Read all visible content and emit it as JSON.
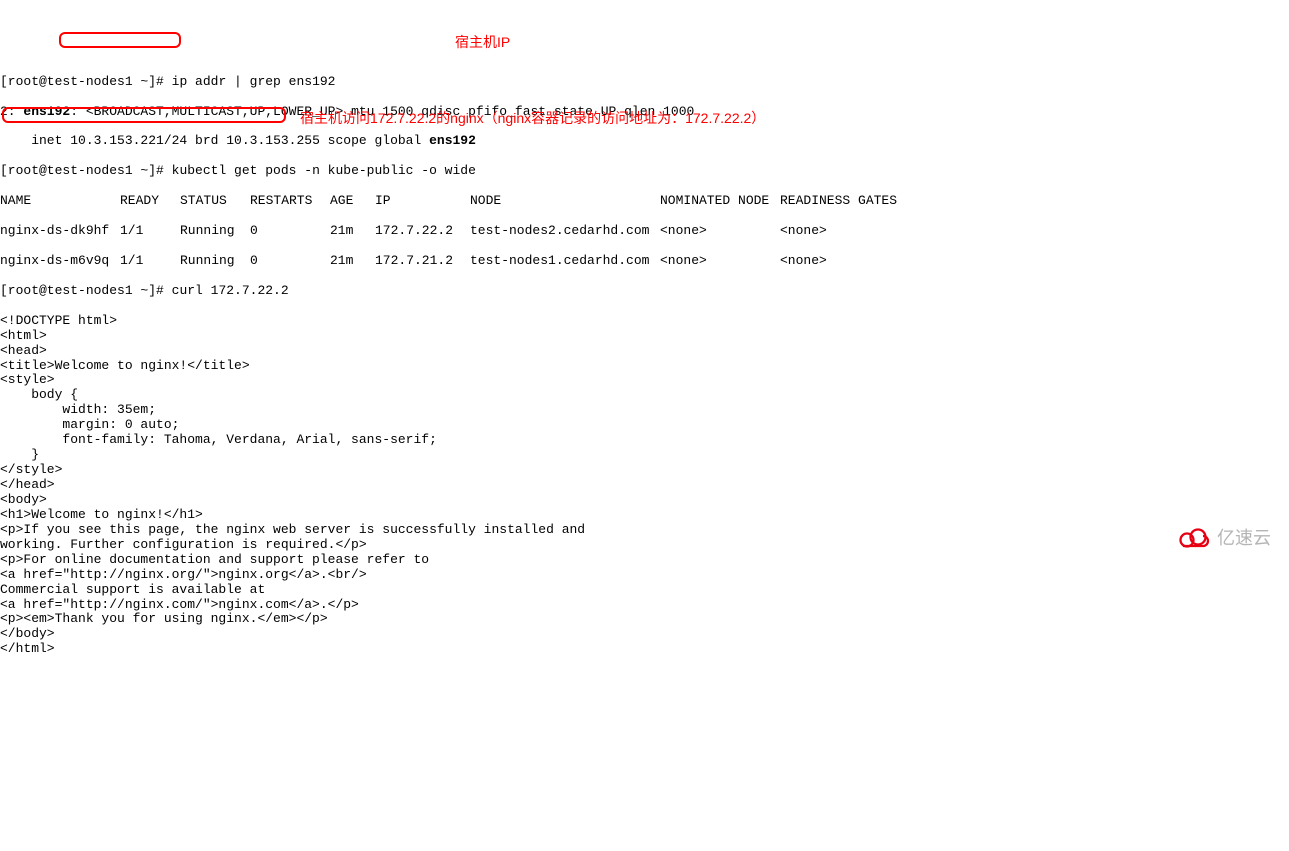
{
  "prompt1": "[root@test-nodes1 ~]# ",
  "cmd1": "ip addr | grep ens192",
  "iface_line_prefix": "2: ",
  "iface_name": "ens192",
  "iface_flags": ": <BROADCAST,MULTICAST,UP,LOWER_UP>",
  "iface_rest": " mtu 1500 qdisc pfifo_fast state UP qlen 1000",
  "inet_prefix": "    inet ",
  "inet_ip": "10.3.153.221/24",
  "inet_mid": " brd 10.3.153.255 scope global ",
  "inet_iface": "ens192",
  "annotation1": "宿主机IP",
  "prompt2": "[root@test-nodes1 ~]# ",
  "cmd2": "kubectl get pods -n kube-public -o wide",
  "headers": {
    "name": "NAME",
    "ready": "READY",
    "status": "STATUS",
    "restarts": "RESTARTS",
    "age": "AGE",
    "ip": "IP",
    "node": "NODE",
    "nominated": "NOMINATED NODE",
    "gates": "READINESS GATES"
  },
  "pods": [
    {
      "name": "nginx-ds-dk9hf",
      "ready": "1/1",
      "status": "Running",
      "restarts": "0",
      "age": "21m",
      "ip": "172.7.22.2",
      "node": "test-nodes2.cedarhd.com",
      "nominated": "<none>",
      "gates": "<none>"
    },
    {
      "name": "nginx-ds-m6v9q",
      "ready": "1/1",
      "status": "Running",
      "restarts": "0",
      "age": "21m",
      "ip": "172.7.21.2",
      "node": "test-nodes1.cedarhd.com",
      "nominated": "<none>",
      "gates": "<none>"
    }
  ],
  "prompt3": "[root@test-nodes1 ~]# ",
  "cmd3": "curl 172.7.22.2",
  "annotation2": "宿主机访问172.7.22.2的nginx（nginx容器记录的访问地址为：172.7.22.2）",
  "html_lines": [
    "<!DOCTYPE html>",
    "<html>",
    "<head>",
    "<title>Welcome to nginx!</title>",
    "<style>",
    "    body {",
    "        width: 35em;",
    "        margin: 0 auto;",
    "        font-family: Tahoma, Verdana, Arial, sans-serif;",
    "    }",
    "</style>",
    "</head>",
    "<body>",
    "<h1>Welcome to nginx!</h1>",
    "<p>If you see this page, the nginx web server is successfully installed and",
    "working. Further configuration is required.</p>",
    "",
    "<p>For online documentation and support please refer to",
    "<a href=\"http://nginx.org/\">nginx.org</a>.<br/>",
    "Commercial support is available at",
    "<a href=\"http://nginx.com/\">nginx.com</a>.</p>",
    "",
    "<p><em>Thank you for using nginx.</em></p>",
    "</body>",
    "</html>"
  ],
  "watermark_text": "亿速云"
}
